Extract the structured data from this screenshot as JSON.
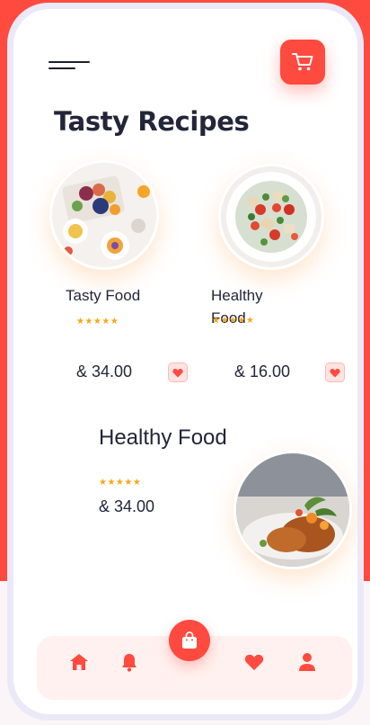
{
  "header": {
    "menu_icon": "hamburger-menu-icon",
    "cart_icon": "shopping-cart-icon",
    "title": "Tasty Recipes"
  },
  "recipes": [
    {
      "name": "Tasty Food",
      "rating": 5,
      "rating_text": "★★★★★",
      "price": "& 34.00",
      "favorite_icon": "heart-icon"
    },
    {
      "name": "Healthy Food",
      "rating": 5,
      "rating_text": "★★★★★",
      "price": "& 16.00",
      "favorite_icon": "heart-icon"
    }
  ],
  "featured": {
    "name": "Healthy Food",
    "rating": 5,
    "rating_text": "★★★★★",
    "price": "& 34.00"
  },
  "bottom_nav": {
    "items": [
      "home-icon",
      "bell-icon",
      "shopping-bag-icon",
      "heart-icon",
      "user-icon"
    ],
    "active": "shopping-bag-icon"
  },
  "colors": {
    "accent": "#ff4a3f",
    "text": "#23253a",
    "star": "#f7a61c",
    "nav_bg": "#fff1ef"
  }
}
